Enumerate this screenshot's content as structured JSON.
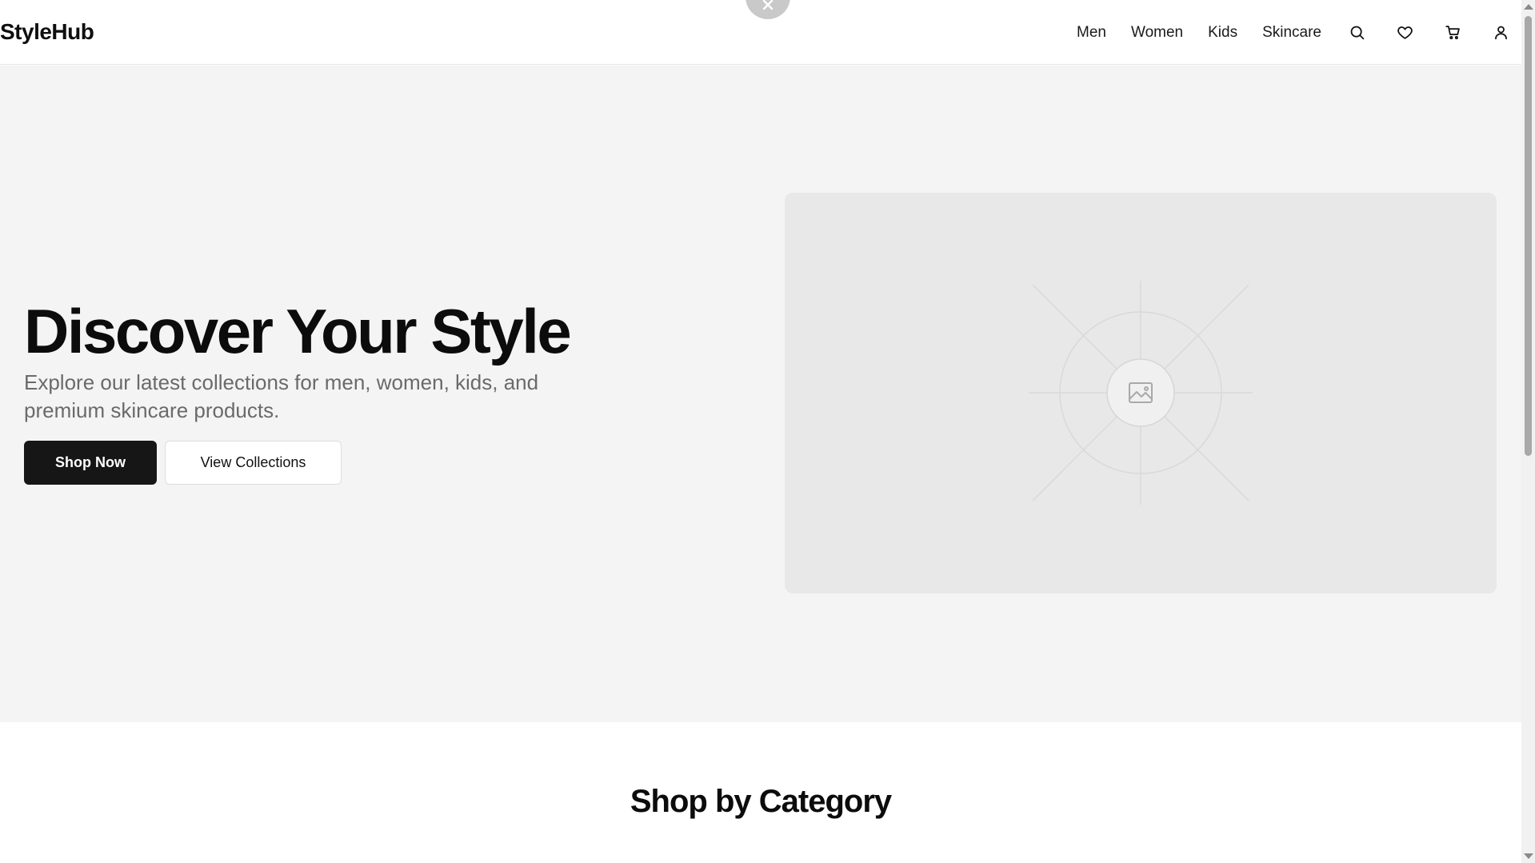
{
  "header": {
    "logo": "StyleHub",
    "nav": [
      "Men",
      "Women",
      "Kids",
      "Skincare"
    ],
    "icons": [
      "search-icon",
      "heart-icon",
      "cart-icon",
      "user-icon"
    ]
  },
  "overlay": {
    "close_icon": "close-icon"
  },
  "hero": {
    "title": "Discover Your Style",
    "subtitle": "Explore our latest collections for men, women, kids, and premium skincare products.",
    "primary_button": "Shop Now",
    "secondary_button": "View Collections",
    "image_icon": "image-placeholder-icon"
  },
  "categories": {
    "title": "Shop by Category"
  },
  "colors": {
    "primary_button_bg": "#161616",
    "hero_bg": "#f4f4f4",
    "image_placeholder_bg": "#e8e8e8"
  }
}
